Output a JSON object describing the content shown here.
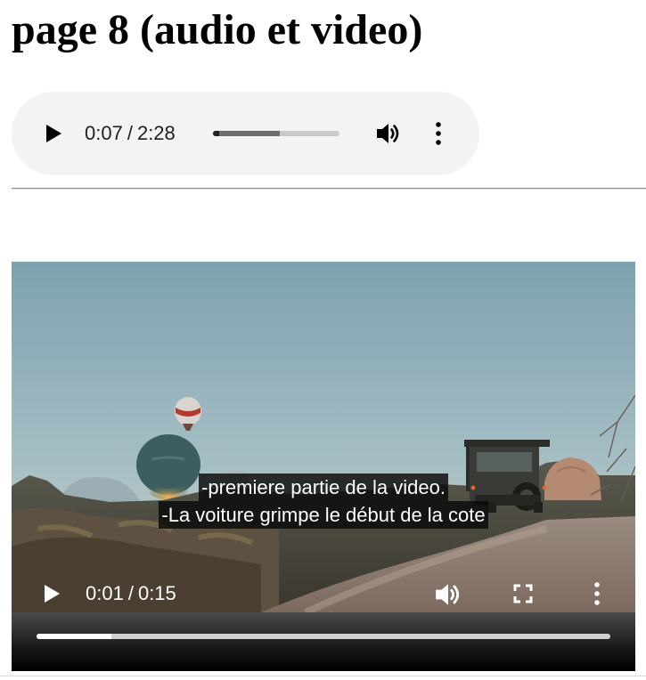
{
  "page": {
    "title": "page 8 (audio et video)"
  },
  "audio": {
    "current_time": "0:07",
    "separator": "/",
    "duration": "2:28",
    "played_fraction": 0.05,
    "buffered_fraction": 0.53,
    "icons": {
      "play": "play-icon",
      "volume": "volume-icon",
      "more": "more-vert-icon"
    },
    "colors": {
      "background": "#f1f3f4",
      "played": "#202124",
      "buffered": "#6e6e6e",
      "track": "#c8c9cb"
    }
  },
  "video": {
    "current_time": "0:01",
    "separator": "/",
    "duration": "0:15",
    "played_fraction": 0.13,
    "captions": [
      "-premiere partie de la video.",
      "-La voiture grimpe le début de la cote"
    ],
    "icons": {
      "play": "play-icon",
      "volume": "volume-icon",
      "fullscreen": "fullscreen-icon",
      "more": "more-vert-icon"
    },
    "scene": "hot air balloons over hills at dusk with an off-road vehicle on a dirt road"
  }
}
